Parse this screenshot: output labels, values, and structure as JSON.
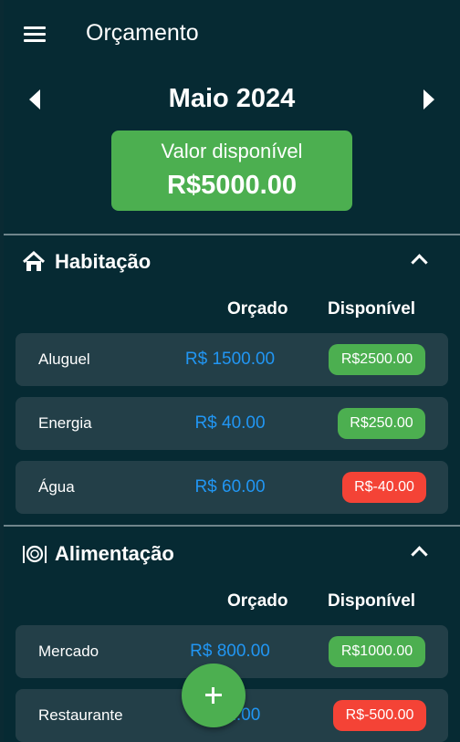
{
  "app": {
    "title": "Orçamento"
  },
  "month": {
    "label": "Maio 2024"
  },
  "available": {
    "label": "Valor disponível",
    "value": "R$5000.00"
  },
  "columns": {
    "budgeted": "Orçado",
    "available": "Disponível"
  },
  "categories": [
    {
      "title": "Habitação",
      "icon": "house-icon",
      "items": [
        {
          "name": "Aluguel",
          "budgeted": "R$ 1500.00",
          "available": "R$2500.00",
          "status": "positive"
        },
        {
          "name": "Energia",
          "budgeted": "R$ 40.00",
          "available": "R$250.00",
          "status": "positive"
        },
        {
          "name": "Água",
          "budgeted": "R$ 60.00",
          "available": "R$-40.00",
          "status": "negative"
        }
      ]
    },
    {
      "title": "Alimentação",
      "icon": "plate-cutlery-icon",
      "items": [
        {
          "name": "Mercado",
          "budgeted": "R$ 800.00",
          "available": "R$1000.00",
          "status": "positive"
        },
        {
          "name": "Restaurante",
          "budgeted": "R$ 2.00",
          "available": "R$-500.00",
          "status": "negative"
        }
      ]
    }
  ],
  "colors": {
    "background": "#062a33",
    "row": "#233f48",
    "positive": "#4caf50",
    "negative": "#f44336",
    "amount": "#2196f3"
  }
}
